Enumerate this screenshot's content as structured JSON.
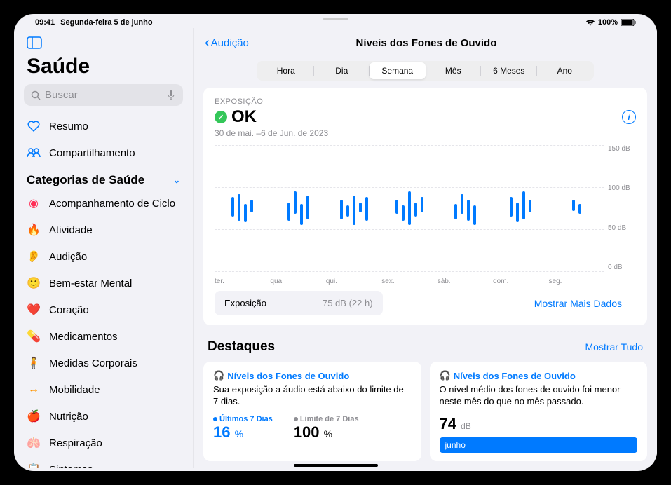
{
  "status": {
    "time": "09:41",
    "date": "Segunda-feira 5 de junho"
  },
  "sidebar": {
    "app_title": "Saúde",
    "search_placeholder": "Buscar",
    "resumo": "Resumo",
    "compartilhamento": "Compartilhamento",
    "categories_title": "Categorias de Saúde",
    "items": [
      {
        "label": "Acompanhamento de Ciclo",
        "icon": "cycle",
        "color": "#ff2d55"
      },
      {
        "label": "Atividade",
        "icon": "flame",
        "color": "#ff3b30"
      },
      {
        "label": "Audição",
        "icon": "ear",
        "color": "#007aff"
      },
      {
        "label": "Bem-estar Mental",
        "icon": "mind",
        "color": "#5ac8b0"
      },
      {
        "label": "Coração",
        "icon": "heart",
        "color": "#ff3b30"
      },
      {
        "label": "Medicamentos",
        "icon": "pills",
        "color": "#5ac8fa"
      },
      {
        "label": "Medidas Corporais",
        "icon": "body",
        "color": "#af52de"
      },
      {
        "label": "Mobilidade",
        "icon": "mobility",
        "color": "#ff9500"
      },
      {
        "label": "Nutrição",
        "icon": "nutrition",
        "color": "#34c759"
      },
      {
        "label": "Respiração",
        "icon": "lungs",
        "color": "#5ac8fa"
      },
      {
        "label": "Sintomas",
        "icon": "symptoms",
        "color": "#af52de"
      }
    ]
  },
  "header": {
    "back": "Audição",
    "title": "Níveis dos Fones de Ouvido"
  },
  "segments": [
    "Hora",
    "Dia",
    "Semana",
    "Mês",
    "6 Meses",
    "Ano"
  ],
  "segment_active": 2,
  "exposure": {
    "label": "EXPOSIÇÃO",
    "status": "OK",
    "range": "30 de mai. –6 de Jun. de 2023",
    "summary_label": "Exposição",
    "summary_value": "75 dB (22 h)",
    "more": "Mostrar Mais Dados"
  },
  "chart_data": {
    "type": "range-bar",
    "ylabel": "dB",
    "ylim": [
      0,
      150
    ],
    "y_ticks": [
      "150 dB",
      "100 dB",
      "50 dB",
      "0 dB"
    ],
    "categories": [
      "ter.",
      "qua.",
      "qui.",
      "sex.",
      "sáb.",
      "dom.",
      "seg."
    ],
    "series": [
      {
        "day": "ter.",
        "bars": [
          [
            65,
            88
          ],
          [
            60,
            92
          ],
          [
            58,
            80
          ],
          [
            70,
            85
          ]
        ]
      },
      {
        "day": "qua.",
        "bars": [
          [
            60,
            82
          ],
          [
            68,
            95
          ],
          [
            55,
            80
          ],
          [
            62,
            90
          ]
        ]
      },
      {
        "day": "qui.",
        "bars": [
          [
            62,
            85
          ],
          [
            65,
            78
          ],
          [
            55,
            90
          ],
          [
            70,
            82
          ],
          [
            60,
            88
          ]
        ]
      },
      {
        "day": "sex.",
        "bars": [
          [
            68,
            85
          ],
          [
            60,
            78
          ],
          [
            55,
            95
          ],
          [
            65,
            82
          ],
          [
            70,
            88
          ]
        ]
      },
      {
        "day": "sáb.",
        "bars": [
          [
            62,
            80
          ],
          [
            68,
            92
          ],
          [
            60,
            85
          ],
          [
            55,
            78
          ]
        ]
      },
      {
        "day": "dom.",
        "bars": [
          [
            65,
            88
          ],
          [
            58,
            82
          ],
          [
            62,
            95
          ],
          [
            70,
            85
          ]
        ]
      },
      {
        "day": "seg.",
        "bars": [
          [
            72,
            85
          ],
          [
            68,
            80
          ]
        ]
      }
    ]
  },
  "highlights": {
    "title": "Destaques",
    "show_all": "Mostrar Tudo",
    "cards": [
      {
        "title": "Níveis dos Fones de Ouvido",
        "desc": "Sua exposição a áudio está abaixo do limite de 7 dias.",
        "stats": [
          {
            "label": "Últimos 7 Dias",
            "value": "16",
            "unit": "%",
            "color": "blue"
          },
          {
            "label": "Limite de 7 Dias",
            "value": "100",
            "unit": "%",
            "color": "gray"
          }
        ]
      },
      {
        "title": "Níveis dos Fones de Ouvido",
        "desc": "O nível médio dos fones de ouvido foi menor neste mês do que no mês passado.",
        "big_value": "74",
        "big_unit": "dB",
        "month": "junho"
      }
    ]
  }
}
